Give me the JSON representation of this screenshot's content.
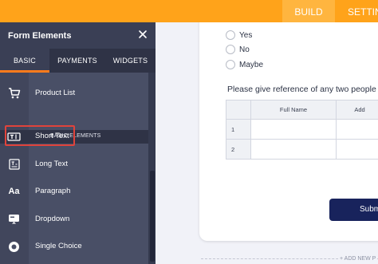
{
  "topbar": {
    "tabs": [
      {
        "label": "BUILD"
      },
      {
        "label": "SETTIN"
      }
    ]
  },
  "sidebar": {
    "title": "Form Elements",
    "close_icon": "close-icon",
    "tabs": [
      {
        "label": "BASIC",
        "active": true
      },
      {
        "label": "PAYMENTS"
      },
      {
        "label": "WIDGETS"
      }
    ],
    "items": [
      {
        "label": "Product List",
        "icon": "cart-icon"
      },
      {
        "label": "Short Text",
        "icon": "short-text-icon",
        "highlighted": true
      },
      {
        "label": "Long Text",
        "icon": "long-text-icon"
      },
      {
        "label": "Paragraph",
        "icon": "paragraph-icon"
      },
      {
        "label": "Dropdown",
        "icon": "dropdown-icon"
      },
      {
        "label": "Single Choice",
        "icon": "single-choice-icon"
      }
    ],
    "section_label": "BASIC ELEMENTS"
  },
  "form": {
    "radio_options": [
      {
        "label": "Yes"
      },
      {
        "label": "No"
      },
      {
        "label": "Maybe"
      }
    ],
    "question": "Please give reference of any two people",
    "table": {
      "headers": [
        "",
        "Full Name",
        "Add"
      ],
      "rows": [
        {
          "num": "1"
        },
        {
          "num": "2"
        }
      ]
    },
    "submit_label": "Subm",
    "add_new_label": "+ ADD NEW P"
  },
  "colors": {
    "accent": "#ffa31a",
    "sidebar_bg": "#3a3f55",
    "highlight": "#e0433b",
    "submit_bg": "#18235c"
  }
}
